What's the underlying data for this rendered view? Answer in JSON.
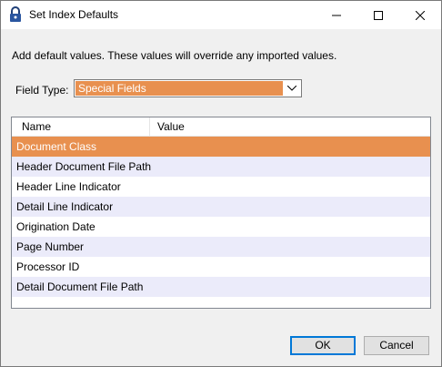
{
  "window": {
    "title": "Set Index Defaults"
  },
  "description": "Add default values. These values will override any imported values.",
  "field_type": {
    "label": "Field Type:",
    "selected": "Special Fields"
  },
  "list": {
    "columns": [
      "Name",
      "Value"
    ],
    "rows": [
      {
        "name": "Document Class",
        "value": ""
      },
      {
        "name": "Header Document File Path",
        "value": ""
      },
      {
        "name": "Header Line Indicator",
        "value": ""
      },
      {
        "name": "Detail Line Indicator",
        "value": ""
      },
      {
        "name": "Origination Date",
        "value": ""
      },
      {
        "name": "Page Number",
        "value": ""
      },
      {
        "name": "Processor ID",
        "value": ""
      },
      {
        "name": "Detail Document File Path",
        "value": ""
      }
    ]
  },
  "buttons": {
    "ok": "OK",
    "cancel": "Cancel"
  },
  "colors": {
    "accent": "#e8904f",
    "alt_row": "#ebebfa",
    "ok_border": "#0078d7"
  }
}
